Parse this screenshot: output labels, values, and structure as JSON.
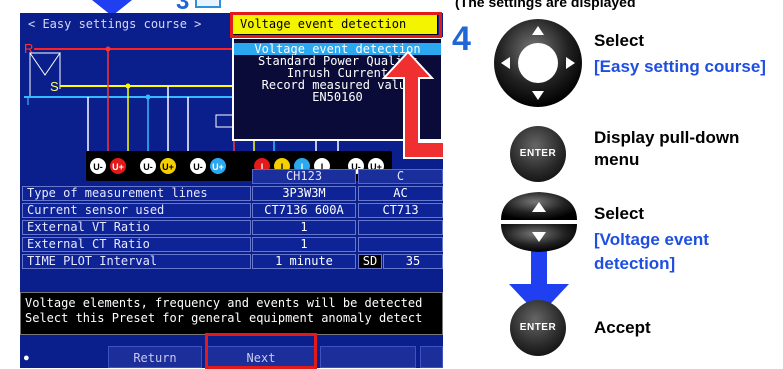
{
  "top_strip": {
    "step_digit": "3",
    "text": "(The settings are displayed"
  },
  "screen": {
    "title": "< Easy settings course >",
    "preset_selected": "Voltage event detection",
    "dropdown_options": [
      "Voltage event detection",
      "Standard Power Quality",
      "Inrush Current",
      "Record measured value",
      "EN50160"
    ],
    "dropdown_selected_index": 0,
    "wiring_labels": {
      "r": "R",
      "s": "S",
      "t": "T"
    },
    "channels": [
      "U-",
      "U+",
      "U-",
      "U+",
      "U-",
      "U+",
      "I",
      "I",
      "I",
      "I",
      "U-",
      "U+"
    ],
    "table": {
      "headers": [
        "CH123",
        "C"
      ],
      "rows": [
        {
          "label": "Type of measurement lines",
          "val1": "3P3W3M",
          "val2": "AC"
        },
        {
          "label": "Current sensor used",
          "val1": "CT7136 600A",
          "val2": "CT713"
        },
        {
          "label": "External VT Ratio",
          "val1": "1",
          "val2": ""
        },
        {
          "label": "External CT Ratio",
          "val1": "1",
          "val2": ""
        },
        {
          "label": "TIME PLOT Interval",
          "val1": "1 minute",
          "val2": "SD",
          "val3": "35"
        }
      ]
    },
    "message_lines": [
      "Voltage elements, frequency and events will be detected",
      "Select this Preset for general equipment anomaly detect"
    ],
    "buttons": {
      "return": "Return",
      "next": "Next"
    }
  },
  "instructions": {
    "step_number": "4",
    "steps": [
      {
        "action": "Select",
        "target": "[Easy setting course]"
      },
      {
        "action": "Display pull-down menu",
        "target": ""
      },
      {
        "action": "Select",
        "target": "[Voltage event detection]"
      },
      {
        "action": "Accept",
        "target": ""
      }
    ],
    "enter_label": "ENTER"
  },
  "colors": {
    "screen_bg": "#0a1f8c",
    "preset_highlight": "#f4f400",
    "selected_item": "#2aa8f0",
    "red_highlight": "#e21a1a",
    "blue_text": "#1f4fe0",
    "arrow_blue": "#1f3ff0"
  }
}
